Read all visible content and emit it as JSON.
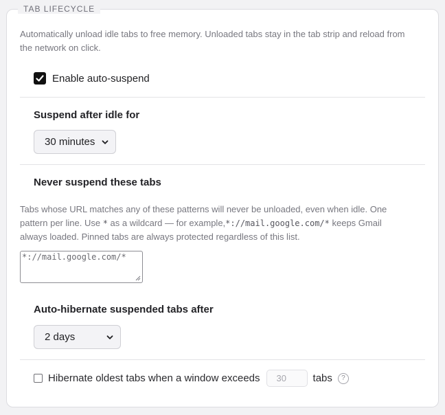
{
  "section": {
    "legend": "TAB LIFECYCLE",
    "description": "Automatically unload idle tabs to free memory. Unloaded tabs stay in the tab strip and reload from the network on click."
  },
  "auto_suspend": {
    "label": "Enable auto-suspend",
    "checked": true
  },
  "idle": {
    "label": "Suspend after idle for",
    "selected": "30 minutes"
  },
  "never_suspend": {
    "label": "Never suspend these tabs",
    "help_1": "Tabs whose URL matches any of these patterns will never be unloaded, even when idle. One pattern per line. Use ",
    "help_wildcard": "*",
    "help_2": " as a wildcard — for example,",
    "help_example": "*://mail.google.com/*",
    "help_3": " keeps Gmail always loaded. Pinned tabs are always protected regardless of this list.",
    "textarea_value": "*://mail.google.com/*"
  },
  "hibernate": {
    "label": "Auto-hibernate suspended tabs after",
    "selected": "2 days"
  },
  "window_limit": {
    "label": "Hibernate oldest tabs when a window exceeds",
    "value": "30",
    "suffix": "tabs",
    "help_icon": "?",
    "checked": false
  },
  "icons": {
    "checkmark": "checkmark-icon",
    "dropdown": "chevron-down-icon",
    "help": "question-mark-icon",
    "resize": "resize-grip-icon"
  },
  "colors": {
    "checkbox_checked": "#111111",
    "muted_text": "#77777f"
  }
}
